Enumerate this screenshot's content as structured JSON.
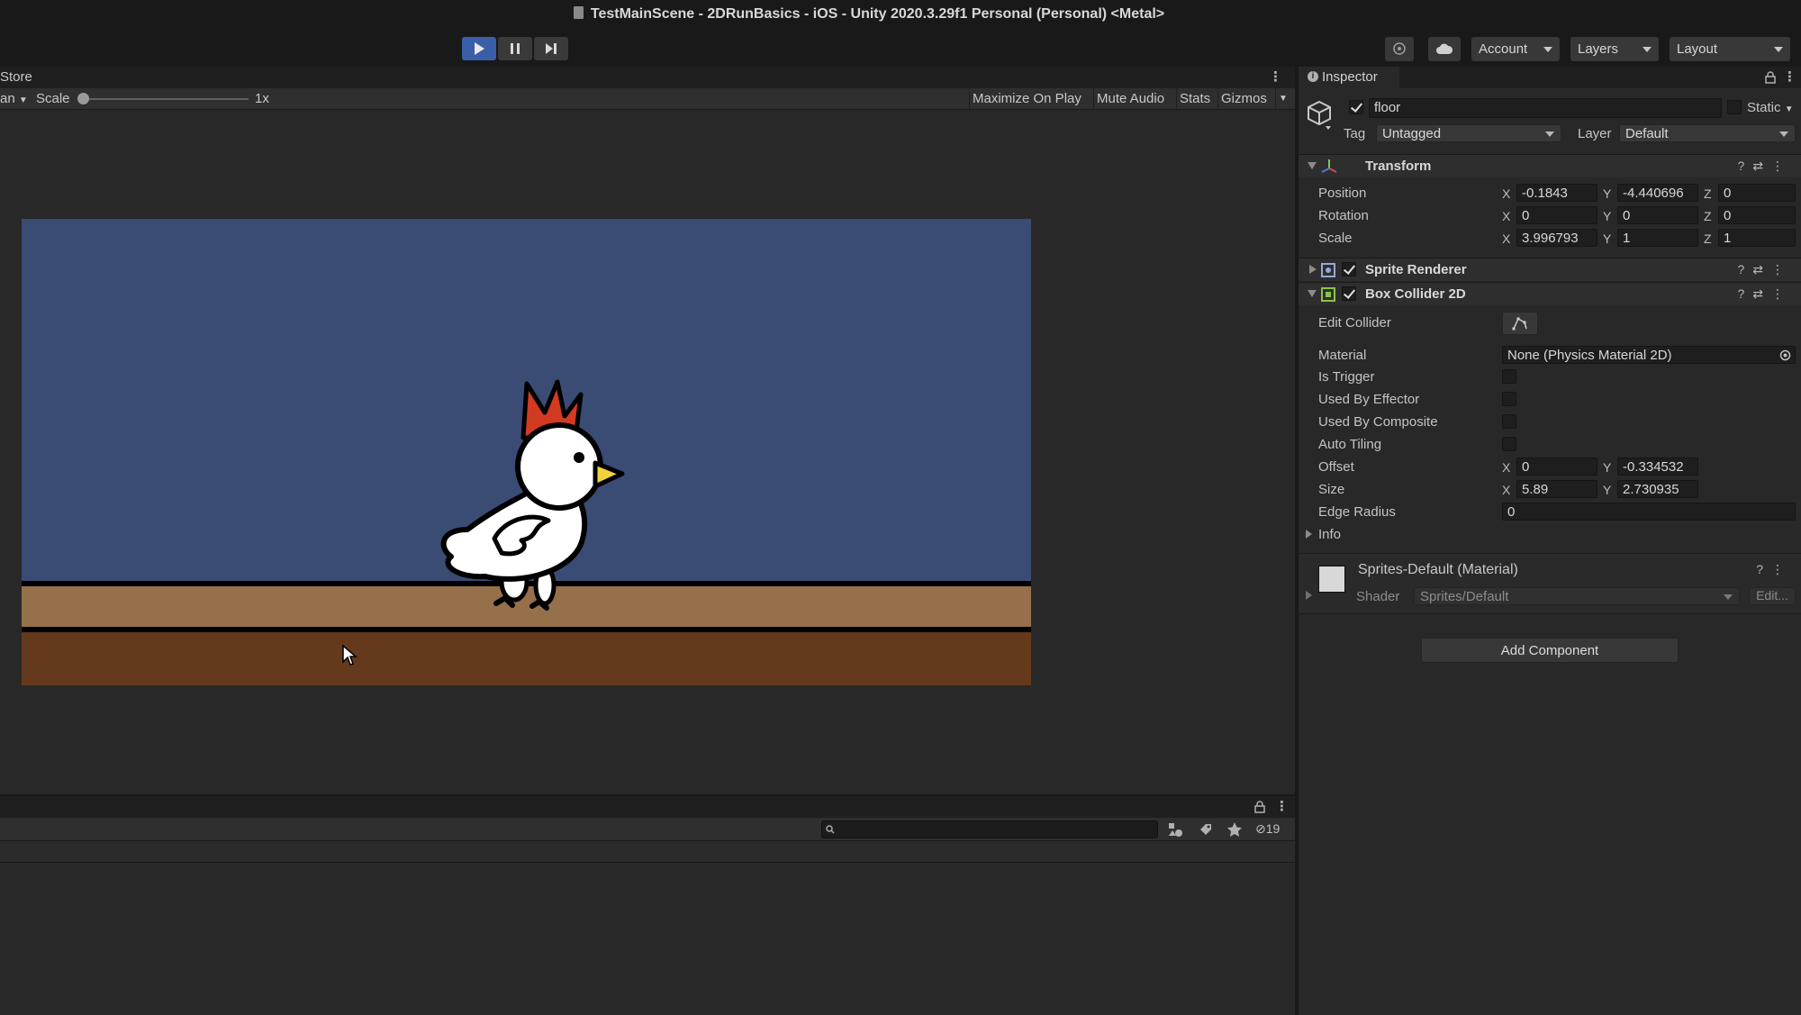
{
  "window": {
    "title": "TestMainScene - 2DRunBasics - iOS - Unity 2020.3.29f1 Personal (Personal) <Metal>"
  },
  "toolbar": {
    "account": "Account",
    "layers": "Layers",
    "layout": "Layout"
  },
  "game_view": {
    "tab_label": "Store",
    "aspect_fragment": "an",
    "scale_label": "Scale",
    "scale_value": "1x",
    "maximize": "Maximize On Play",
    "mute": "Mute Audio",
    "stats": "Stats",
    "gizmos": "Gizmos",
    "colors": {
      "sky": "#3a4c74",
      "ground_light": "#95704b",
      "ground_dark": "#65391c"
    }
  },
  "console": {
    "hidden_count": "19"
  },
  "inspector": {
    "tab": "Inspector",
    "object_name": "floor",
    "static_label": "Static",
    "tag_label": "Tag",
    "tag_value": "Untagged",
    "layer_label": "Layer",
    "layer_value": "Default",
    "transform": {
      "title": "Transform",
      "position_label": "Position",
      "position": {
        "x": "-0.1843",
        "y": "-4.440696",
        "z": "0"
      },
      "rotation_label": "Rotation",
      "rotation": {
        "x": "0",
        "y": "0",
        "z": "0"
      },
      "scale_label": "Scale",
      "scale": {
        "x": "3.996793",
        "y": "1",
        "z": "1"
      }
    },
    "sprite_renderer": {
      "title": "Sprite Renderer"
    },
    "box_collider": {
      "title": "Box Collider 2D",
      "edit_collider": "Edit Collider",
      "material_label": "Material",
      "material_value": "None (Physics Material 2D)",
      "is_trigger": "Is Trigger",
      "used_by_effector": "Used By Effector",
      "used_by_composite": "Used By Composite",
      "auto_tiling": "Auto Tiling",
      "offset_label": "Offset",
      "offset": {
        "x": "0",
        "y": "-0.334532"
      },
      "size_label": "Size",
      "size": {
        "x": "5.89",
        "y": "2.730935"
      },
      "edge_radius_label": "Edge Radius",
      "edge_radius": "0",
      "info": "Info"
    },
    "material": {
      "name": "Sprites-Default (Material)",
      "shader_label": "Shader",
      "shader_value": "Sprites/Default",
      "edit": "Edit..."
    },
    "add_component": "Add Component"
  }
}
